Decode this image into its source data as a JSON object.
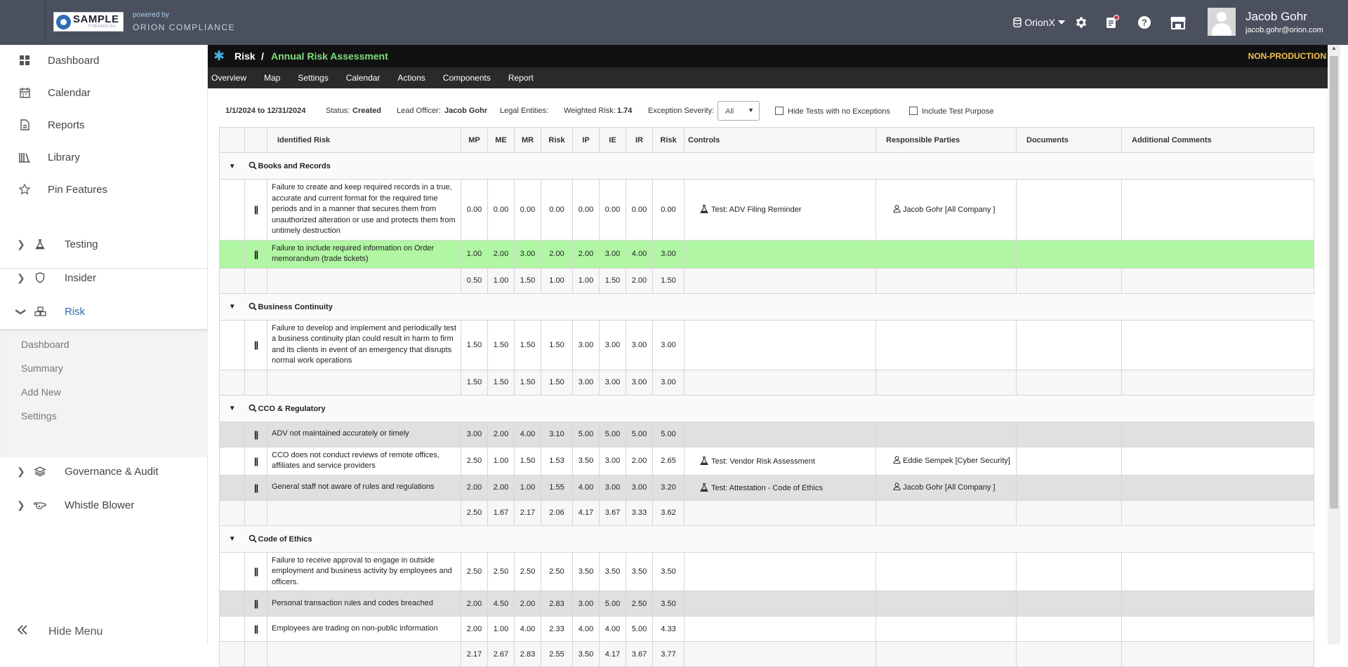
{
  "topbar": {
    "logo_text": "SAMPLE",
    "logo_subtext": "FINANCIAL",
    "powered_by": "powered by",
    "brand": "ORION COMPLIANCE",
    "tenant": "OrionX",
    "user_name": "Jacob Gohr",
    "user_email": "jacob.gohr@orion.com",
    "notification_color": "#e0305a"
  },
  "sidebar": {
    "items": [
      {
        "label": "Dashboard",
        "icon": "grid-icon"
      },
      {
        "label": "Calendar",
        "icon": "calendar-icon"
      },
      {
        "label": "Reports",
        "icon": "document-icon"
      },
      {
        "label": "Library",
        "icon": "library-icon"
      },
      {
        "label": "Pin Features",
        "icon": "star-icon"
      }
    ],
    "modules": [
      {
        "label": "Testing",
        "icon": "flask-icon",
        "expanded": false
      },
      {
        "label": "Insider",
        "icon": "shield-icon",
        "expanded": false
      },
      {
        "label": "Risk",
        "icon": "cubes-icon",
        "expanded": true
      },
      {
        "label": "Governance & Audit",
        "icon": "layers-icon",
        "expanded": false
      },
      {
        "label": "Whistle Blower",
        "icon": "whistle-icon",
        "expanded": false
      }
    ],
    "risk_sub": [
      "Dashboard",
      "Summary",
      "Add New",
      "Settings"
    ],
    "hide_menu": "Hide Menu",
    "active_color": "#2a6db0"
  },
  "breadcrumb": {
    "section": "Risk",
    "separator": "/",
    "page": "Annual Risk Assessment",
    "env": "NON-PRODUCTION"
  },
  "tabs": [
    "Overview",
    "Map",
    "Settings",
    "Calendar",
    "Actions",
    "Components",
    "Report"
  ],
  "filters": {
    "date_range": "1/1/2024 to 12/31/2024",
    "status_label": "Status:",
    "status_value": "Created",
    "lead_label": "Lead Officer:",
    "lead_value": "Jacob Gohr",
    "legal_label": "Legal Entities:",
    "weighted_label": "Weighted Risk:",
    "weighted_value": "1.74",
    "severity_label": "Exception Severity:",
    "severity_value": "All",
    "hide_tests": "Hide Tests with no Exceptions",
    "include_purpose": "Include Test Purpose"
  },
  "table": {
    "headers": [
      "Identified Risk",
      "MP",
      "ME",
      "MR",
      "Risk",
      "IP",
      "IE",
      "IR",
      "Risk",
      "Controls",
      "Responsible Parties",
      "Documents",
      "Additional Comments"
    ],
    "groups": [
      {
        "name": "Books and Records",
        "rows": [
          {
            "risk": "Failure to create and keep required records in a true, accurate and current format for the required time periods and in a manner that secures them from unauthorized alteration or use and protects them from untimely destruction",
            "vals": [
              "0.00",
              "0.00",
              "0.00",
              "0.00",
              "0.00",
              "0.00",
              "0.00",
              "0.00"
            ],
            "control": "Test: ADV Filing Reminder",
            "party": "Jacob Gohr [All Company ]",
            "style": "white"
          },
          {
            "risk": "Failure to include required information on Order memorandum (trade tickets)",
            "vals": [
              "1.00",
              "2.00",
              "3.00",
              "2.00",
              "2.00",
              "3.00",
              "4.00",
              "3.00"
            ],
            "control": "",
            "party": "",
            "style": "highlight"
          }
        ],
        "summary": [
          "0.50",
          "1.00",
          "1.50",
          "1.00",
          "1.00",
          "1.50",
          "2.00",
          "1.50"
        ]
      },
      {
        "name": "Business Continuity",
        "rows": [
          {
            "risk": "Failure to develop and implement and periodically test a business continuity plan could result in harm to firm and its clients in event of an emergency that disrupts normal work operations",
            "vals": [
              "1.50",
              "1.50",
              "1.50",
              "1.50",
              "3.00",
              "3.00",
              "3.00",
              "3.00"
            ],
            "control": "",
            "party": "",
            "style": "white"
          }
        ],
        "summary": [
          "1.50",
          "1.50",
          "1.50",
          "1.50",
          "3.00",
          "3.00",
          "3.00",
          "3.00"
        ]
      },
      {
        "name": "CCO & Regulatory",
        "rows": [
          {
            "risk": "ADV not maintained accurately or timely",
            "vals": [
              "3.00",
              "2.00",
              "4.00",
              "3.10",
              "5.00",
              "5.00",
              "5.00",
              "5.00"
            ],
            "control": "",
            "party": "",
            "style": "band"
          },
          {
            "risk": "CCO does not conduct reviews of remote offices, affiliates and service providers",
            "vals": [
              "2.50",
              "1.00",
              "1.50",
              "1.53",
              "3.50",
              "3.00",
              "2.00",
              "2.65"
            ],
            "control": "Test: Vendor Risk Assessment",
            "party": "Eddie Sempek [Cyber Security]",
            "style": "white"
          },
          {
            "risk": "General staff not aware of rules and regulations",
            "vals": [
              "2.00",
              "2.00",
              "1.00",
              "1.55",
              "4.00",
              "3.00",
              "3.00",
              "3.20"
            ],
            "control": "Test: Attestation - Code of Ethics",
            "party": "Jacob Gohr [All Company ]",
            "style": "band"
          }
        ],
        "summary": [
          "2.50",
          "1.67",
          "2.17",
          "2.06",
          "4.17",
          "3.67",
          "3.33",
          "3.62"
        ]
      },
      {
        "name": "Code of Ethics",
        "rows": [
          {
            "risk": "Failure to receive approval to engage in outside employment and business activity by employees and officers.",
            "vals": [
              "2.50",
              "2.50",
              "2.50",
              "2.50",
              "3.50",
              "3.50",
              "3.50",
              "3.50"
            ],
            "control": "",
            "party": "",
            "style": "white"
          },
          {
            "risk": "Personal transaction rules and codes breached",
            "vals": [
              "2.00",
              "4.50",
              "2.00",
              "2.83",
              "3.00",
              "5.00",
              "2.50",
              "3.50"
            ],
            "control": "",
            "party": "",
            "style": "band"
          },
          {
            "risk": "Employees are trading on non-public information",
            "vals": [
              "2.00",
              "1.00",
              "4.00",
              "2.33",
              "4.00",
              "4.00",
              "5.00",
              "4.33"
            ],
            "control": "",
            "party": "",
            "style": "white"
          }
        ],
        "summary": [
          "2.17",
          "2.67",
          "2.83",
          "2.55",
          "3.50",
          "4.17",
          "3.67",
          "3.77"
        ]
      }
    ]
  }
}
